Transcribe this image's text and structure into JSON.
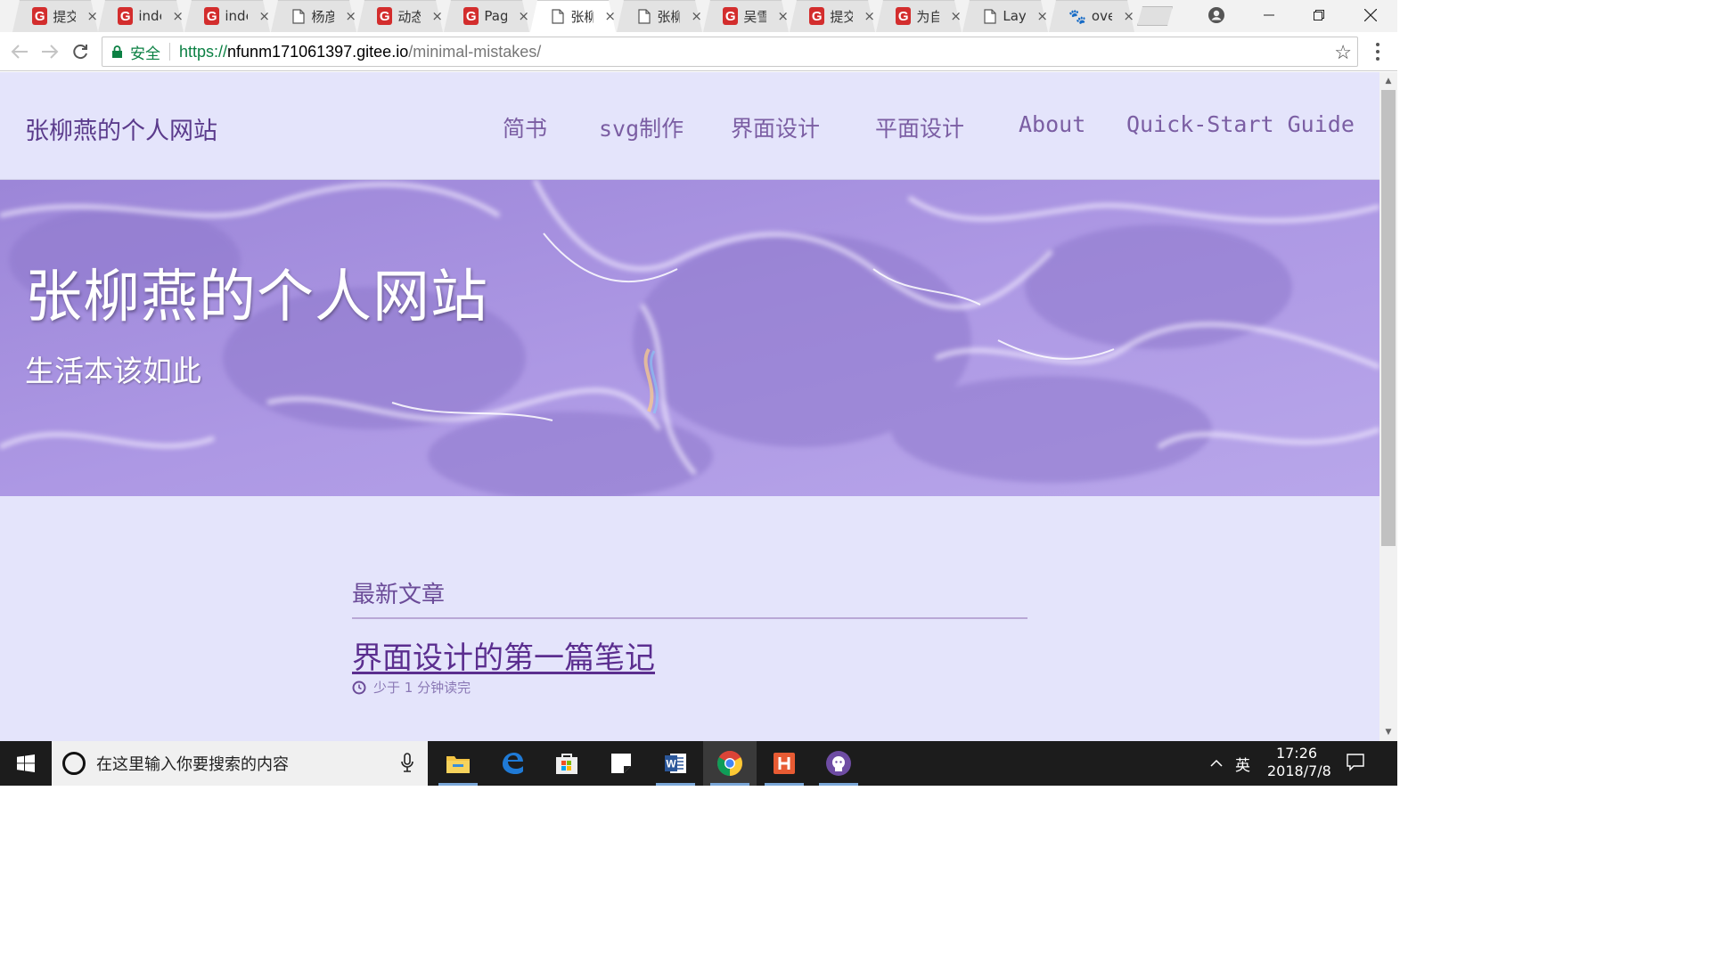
{
  "browser": {
    "tabs": [
      {
        "label": "提交",
        "icon": "gitee-icon"
      },
      {
        "label": "index",
        "icon": "gitee-icon"
      },
      {
        "label": "index",
        "icon": "gitee-icon"
      },
      {
        "label": "杨彦",
        "icon": "document-icon"
      },
      {
        "label": "动态",
        "icon": "gitee-icon"
      },
      {
        "label": "Pag",
        "icon": "gitee-icon"
      },
      {
        "label": "张柳",
        "icon": "document-icon",
        "active": true
      },
      {
        "label": "张柳",
        "icon": "document-icon"
      },
      {
        "label": "吴雪",
        "icon": "gitee-icon"
      },
      {
        "label": "提交",
        "icon": "gitee-icon"
      },
      {
        "label": "为自",
        "icon": "gitee-icon"
      },
      {
        "label": "Lay",
        "icon": "document-icon"
      },
      {
        "label": "ove",
        "icon": "baidu-paw-icon"
      }
    ],
    "close_glyph": "×",
    "address": {
      "security_label": "安全",
      "scheme": "https://",
      "host": "nfunm171061397.gitee.io",
      "path": "/minimal-mistakes/"
    }
  },
  "site": {
    "title": "张柳燕的个人网站",
    "nav": [
      "简书",
      "svg制作",
      "界面设计",
      "平面设计",
      "About",
      "Quick-Start Guide"
    ],
    "hero": {
      "title": "张柳燕的个人网站",
      "subtitle": "生活本该如此"
    },
    "recent": {
      "heading": "最新文章",
      "post_title": "界面设计的第一篇笔记",
      "read_time": "少于 1 分钟读完"
    }
  },
  "taskbar": {
    "search_placeholder": "在这里输入你要搜索的内容",
    "ime": "英",
    "time": "17:26",
    "date": "2018/7/8",
    "apps": [
      "file-explorer-icon",
      "edge-icon",
      "store-icon",
      "sticky-notes-icon",
      "word-icon",
      "chrome-icon",
      "hbuilder-icon",
      "github-desktop-icon"
    ]
  },
  "colors": {
    "page_bg": "#e4e4fb",
    "site_title": "#5b3b8c",
    "nav_link": "#7b5ea3",
    "hero_tint": "#a48fdc",
    "secure_green": "#0b8043"
  }
}
